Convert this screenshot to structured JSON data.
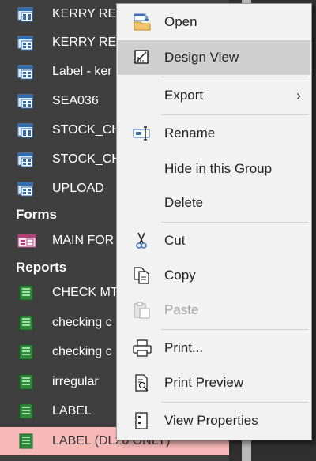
{
  "nav": {
    "items": [
      {
        "label": "KERRY REP",
        "type": "query"
      },
      {
        "label": "KERRY REP",
        "type": "query"
      },
      {
        "label": "Label - ker",
        "type": "query"
      },
      {
        "label": "SEA036",
        "type": "query"
      },
      {
        "label": "STOCK_CH",
        "type": "query"
      },
      {
        "label": "STOCK_CH",
        "type": "query"
      },
      {
        "label": "UPLOAD",
        "type": "query"
      }
    ],
    "forms_header": "Forms",
    "forms": [
      {
        "label": "MAIN FOR",
        "type": "form"
      }
    ],
    "reports_header": "Reports",
    "reports": [
      {
        "label": "CHECK MT",
        "type": "report"
      },
      {
        "label": "checking c",
        "type": "report"
      },
      {
        "label": "checking c",
        "type": "report"
      },
      {
        "label": "irregular",
        "type": "report"
      },
      {
        "label": "LABEL",
        "type": "report"
      },
      {
        "label": "LABEL (DL20 ONLY)",
        "type": "report",
        "selected": true
      }
    ]
  },
  "menu": {
    "open": "Open",
    "design_view": "Design View",
    "export": "Export",
    "rename": "Rename",
    "hide_in_group": "Hide in this Group",
    "delete": "Delete",
    "cut": "Cut",
    "copy": "Copy",
    "paste": "Paste",
    "print": "Print...",
    "print_preview": "Print Preview",
    "view_properties": "View Properties",
    "submenu_arrow": "›"
  },
  "colors": {
    "pane_bg": "#3f3f3f",
    "selected_row": "#f7b8b8",
    "menu_bg": "#f2f2f2",
    "menu_hover": "#cfcfcf"
  }
}
